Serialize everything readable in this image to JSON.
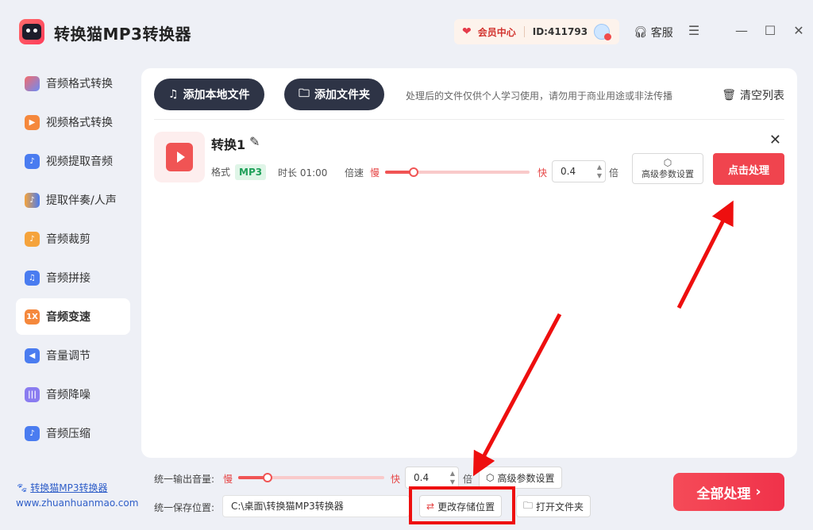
{
  "app": {
    "title": "转换猫MP3转换器",
    "member_label": "会员中心",
    "user_id": "ID:411793",
    "service_label": "客服"
  },
  "sidebar": {
    "items": [
      {
        "label": "音频格式转换",
        "icon": "audio-format-icon"
      },
      {
        "label": "视频格式转换",
        "icon": "video-format-icon"
      },
      {
        "label": "视频提取音频",
        "icon": "video-extract-icon"
      },
      {
        "label": "提取伴奏/人声",
        "icon": "vocal-extract-icon"
      },
      {
        "label": "音频裁剪",
        "icon": "audio-cut-icon"
      },
      {
        "label": "音频拼接",
        "icon": "audio-join-icon"
      },
      {
        "label": "音频变速",
        "icon": "audio-speed-icon",
        "icon_text": "1X"
      },
      {
        "label": "音量调节",
        "icon": "volume-icon"
      },
      {
        "label": "音频降噪",
        "icon": "denoise-icon"
      },
      {
        "label": "音频压缩",
        "icon": "compress-icon"
      }
    ],
    "active_index": 6,
    "footer": {
      "brand_link": "转换猫MP3转换器",
      "url": "www.zhuanhuanmao.com"
    }
  },
  "toolbar": {
    "add_file": "添加本地文件",
    "add_folder": "添加文件夹",
    "notice": "处理后的文件仅供个人学习使用，请勿用于商业用途或非法传播",
    "clear_list": "清空列表"
  },
  "file": {
    "name": "转换1",
    "format_label": "格式",
    "format": "MP3",
    "duration_label": "时长",
    "duration": "01:00",
    "speed_label": "倍速",
    "slow": "慢",
    "fast": "快",
    "speed_value": "0.4",
    "speed_fraction": 0.2,
    "times": "倍",
    "advanced": "高级参数设置",
    "process": "点击处理"
  },
  "bottom": {
    "volume_label": "统一输出音量:",
    "slow": "慢",
    "fast": "快",
    "volume_value": "0.4",
    "volume_fraction": 0.2,
    "times": "倍",
    "advanced": "高级参数设置",
    "save_label": "统一保存位置:",
    "save_path": "C:\\桌面\\转换猫MP3转换器",
    "change_location": "更改存储位置",
    "open_folder": "打开文件夹",
    "process_all": "全部处理"
  },
  "colors": {
    "accent": "#f0444e",
    "dark_button": "#2e3446",
    "annotation": "#ee0f0f"
  }
}
